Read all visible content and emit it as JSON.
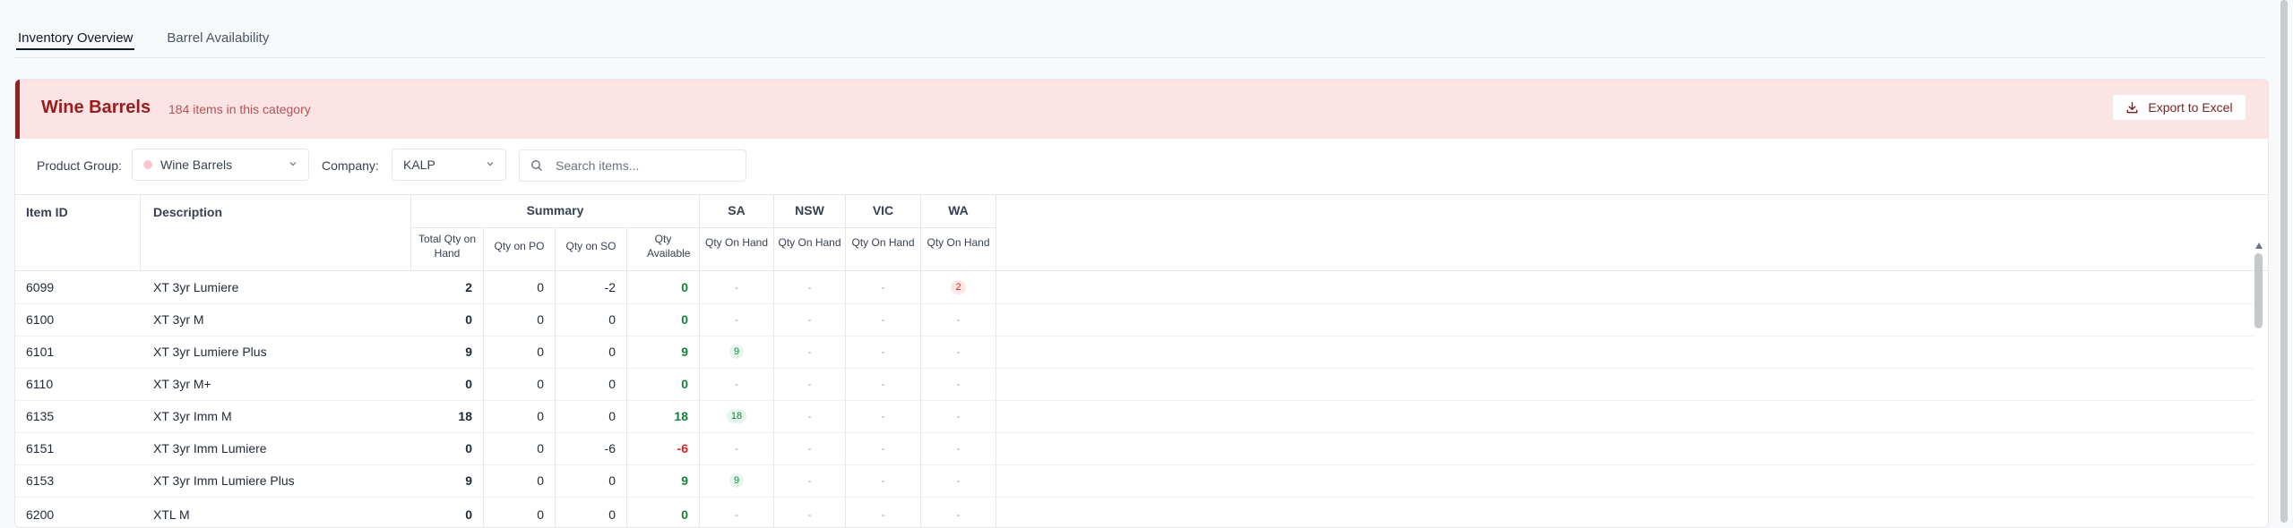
{
  "tabs": [
    {
      "label": "Inventory Overview",
      "active": true
    },
    {
      "label": "Barrel Availability",
      "active": false
    }
  ],
  "banner": {
    "title": "Wine Barrels",
    "subtitle": "184 items in this category",
    "export_label": "Export to Excel"
  },
  "filters": {
    "product_group_label": "Product Group:",
    "product_group_value": "Wine Barrels",
    "company_label": "Company:",
    "company_value": "KALP",
    "search_placeholder": "Search items..."
  },
  "table": {
    "headers": {
      "item_id": "Item ID",
      "description": "Description",
      "summary": "Summary",
      "total_qty": "Total Qty on Hand",
      "qty_po": "Qty on PO",
      "qty_so": "Qty on SO",
      "qty_available": "Qty Available",
      "regions": [
        "SA",
        "NSW",
        "VIC",
        "WA"
      ],
      "region_sub": "Qty On Hand"
    },
    "rows": [
      {
        "id": "6099",
        "desc": "XT 3yr Lumiere",
        "total": "2",
        "po": "0",
        "so": "-2",
        "avail": "0",
        "avail_tone": "green",
        "sa": "-",
        "nsw": "-",
        "vic": "-",
        "wa": "2",
        "wa_tone": "red"
      },
      {
        "id": "6100",
        "desc": "XT 3yr M",
        "total": "0",
        "po": "0",
        "so": "0",
        "avail": "0",
        "avail_tone": "green",
        "sa": "-",
        "nsw": "-",
        "vic": "-",
        "wa": "-"
      },
      {
        "id": "6101",
        "desc": "XT 3yr Lumiere Plus",
        "total": "9",
        "po": "0",
        "so": "0",
        "avail": "9",
        "avail_tone": "green",
        "sa": "9",
        "sa_tone": "green",
        "nsw": "-",
        "vic": "-",
        "wa": "-"
      },
      {
        "id": "6110",
        "desc": "XT 3yr M+",
        "total": "0",
        "po": "0",
        "so": "0",
        "avail": "0",
        "avail_tone": "green",
        "sa": "-",
        "nsw": "-",
        "vic": "-",
        "wa": "-"
      },
      {
        "id": "6135",
        "desc": "XT 3yr Imm M",
        "total": "18",
        "po": "0",
        "so": "0",
        "avail": "18",
        "avail_tone": "green",
        "sa": "18",
        "sa_tone": "green",
        "nsw": "-",
        "vic": "-",
        "wa": "-"
      },
      {
        "id": "6151",
        "desc": "XT 3yr Imm Lumiere",
        "total": "0",
        "po": "0",
        "so": "-6",
        "avail": "-6",
        "avail_tone": "red",
        "sa": "-",
        "nsw": "-",
        "vic": "-",
        "wa": "-"
      },
      {
        "id": "6153",
        "desc": "XT 3yr Imm Lumiere Plus",
        "total": "9",
        "po": "0",
        "so": "0",
        "avail": "9",
        "avail_tone": "green",
        "sa": "9",
        "sa_tone": "green",
        "nsw": "-",
        "vic": "-",
        "wa": "-"
      },
      {
        "id": "6200",
        "desc": "XTL M",
        "total": "0",
        "po": "0",
        "so": "0",
        "avail": "0",
        "avail_tone": "green",
        "sa": "-",
        "nsw": "-",
        "vic": "-",
        "wa": "-"
      }
    ]
  },
  "colors": {
    "accent": "#9b1c1c",
    "banner_bg": "#fde4e4",
    "positive": "#15803d",
    "negative": "#dc2626"
  },
  "icons": {
    "export": "download-icon",
    "dropdown": "chevron-down-icon",
    "search": "search-icon"
  }
}
